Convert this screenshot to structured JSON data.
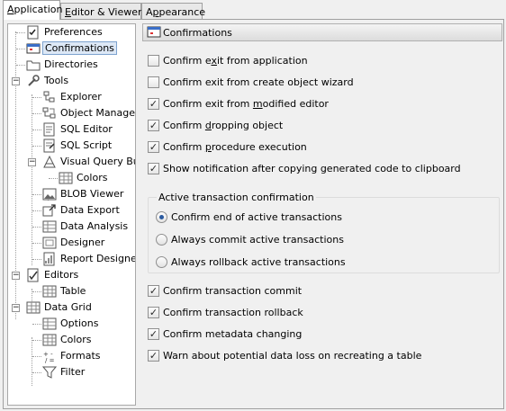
{
  "tabs": [
    {
      "label_pre": "",
      "label_u": "A",
      "label_post": "pplication",
      "active": true
    },
    {
      "label_pre": "",
      "label_u": "E",
      "label_post": "ditor & Viewers",
      "active": false
    },
    {
      "label_pre": "A",
      "label_u": "p",
      "label_post": "pearance",
      "active": false
    }
  ],
  "tree": {
    "items": [
      {
        "label": "Preferences",
        "icon": "preferences-icon"
      },
      {
        "label": "Confirmations",
        "icon": "confirmations-icon",
        "selected": true
      },
      {
        "label": "Directories",
        "icon": "folder-icon"
      },
      {
        "label": "Tools",
        "icon": "tools-icon",
        "expanded": true
      },
      {
        "label": "Explorer",
        "icon": "explorer-icon"
      },
      {
        "label": "Object Manager",
        "icon": "object-manager-icon"
      },
      {
        "label": "SQL Editor",
        "icon": "sql-editor-icon"
      },
      {
        "label": "SQL Script",
        "icon": "sql-script-icon"
      },
      {
        "label": "Visual Query Build",
        "icon": "visual-query-builder-icon",
        "expanded": true
      },
      {
        "label": "Colors",
        "icon": "colors-icon"
      },
      {
        "label": "BLOB Viewer",
        "icon": "blob-viewer-icon"
      },
      {
        "label": "Data Export",
        "icon": "data-export-icon"
      },
      {
        "label": "Data Analysis",
        "icon": "data-analysis-icon"
      },
      {
        "label": "Designer",
        "icon": "designer-icon"
      },
      {
        "label": "Report Designer",
        "icon": "report-designer-icon"
      },
      {
        "label": "Editors",
        "icon": "editors-icon",
        "expanded": true
      },
      {
        "label": "Table",
        "icon": "table-icon"
      },
      {
        "label": "Data Grid",
        "icon": "data-grid-icon",
        "expanded": true
      },
      {
        "label": "Options",
        "icon": "options-icon"
      },
      {
        "label": "Colors",
        "icon": "grid-colors-icon"
      },
      {
        "label": "Formats",
        "icon": "formats-icon"
      },
      {
        "label": "Filter",
        "icon": "filter-icon"
      }
    ]
  },
  "panel": {
    "title": "Confirmations",
    "checkboxes_top": [
      {
        "pre": "Confirm e",
        "u": "x",
        "post": "it from application",
        "checked": false
      },
      {
        "pre": "Confirm exit from create object wizard",
        "u": "",
        "post": "",
        "checked": false
      },
      {
        "pre": "Confirm exit from ",
        "u": "m",
        "post": "odified editor",
        "checked": true
      },
      {
        "pre": "Confirm ",
        "u": "d",
        "post": "ropping object",
        "checked": true
      },
      {
        "pre": "Confirm ",
        "u": "p",
        "post": "rocedure execution",
        "checked": true
      },
      {
        "pre": "Show notification after copying generated code to clipboard",
        "u": "",
        "post": "",
        "checked": true
      }
    ],
    "group": {
      "title": "Active transaction confirmation",
      "radios": [
        {
          "label": "Confirm end of active transactions",
          "checked": true
        },
        {
          "label": "Always commit active transactions",
          "checked": false
        },
        {
          "label": "Always rollback active transactions",
          "checked": false
        }
      ]
    },
    "checkboxes_bottom": [
      {
        "label": "Confirm transaction commit",
        "checked": true
      },
      {
        "label": "Confirm transaction rollback",
        "checked": true
      },
      {
        "label": "Confirm metadata changing",
        "checked": true
      },
      {
        "label": "Warn about potential data loss on recreating a table",
        "checked": true
      }
    ]
  }
}
